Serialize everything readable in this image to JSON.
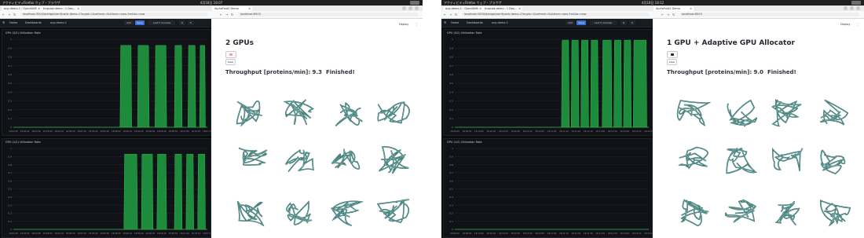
{
  "colors": {
    "topbar": "#1f1f1f",
    "grafana_bg": "#0b0c0e",
    "panel_bg": "#111217",
    "bar_fill": "#1e8a3c",
    "bar_line": "#2db84d",
    "protein": "#2f6e6a",
    "run_dot_left": "#f19fa3",
    "run_dot_right": "#262730"
  },
  "screens": [
    {
      "desktop": {
        "activities": "アクティビティ",
        "app": "Firefox ウェブ・ブラウザ",
        "clock": "4月18日 18:07"
      },
      "tabs": [
        "ocp-demo-1 : OpenShift",
        "tmpcad-demo : 1 Das…",
        "AlphaFold2 Demo"
      ],
      "url_left": "localhost:3000/d/edge/zamf/cacb-demo-1?orgId=1&refresh=5s&from=now-5m&to=now",
      "url_right": "localhost:8503",
      "grafana": {
        "nav": [
          "Home",
          "Dashboards",
          "ocp-demo-1"
        ],
        "buttons": [
          "Add",
          "Save",
          "Last 5 minutes"
        ],
        "panels": [
          {
            "title": "GPU (0/2) Utilization Rate",
            "y_ticks": [
              "1",
              "0.9",
              "0.8",
              "0.7",
              "0.6",
              "0.5",
              "0.4",
              "0.3",
              "0.2",
              "0.1",
              "0"
            ]
          },
          {
            "title": "GPU (1/2) Utilization Rate",
            "y_ticks": [
              "1",
              "0.9",
              "0.8",
              "0.7",
              "0.6",
              "0.5",
              "0.4",
              "0.3",
              "0.2",
              "0.1",
              "0"
            ]
          }
        ]
      },
      "streamlit": {
        "header_items": [
          "Deploy",
          "⋮"
        ],
        "title": "2 GPUs",
        "clear": "Clear",
        "throughput": "Throughput [proteins/min]: 9.3",
        "status": "Finished!"
      }
    },
    {
      "desktop": {
        "activities": "アクティビティ",
        "app": "Firefox ウェブ・ブラウザ",
        "clock": "4月18日 18:12"
      },
      "tabs": [
        "ocp-demo-1 : OpenShift",
        "tmpcad-demo : 1 Das…",
        "AlphaFold2 Demo"
      ],
      "url_left": "localhost:3000/d/edge/zamf/cacb-demo-2?orgId=1&refresh=5s&from=now-5m&to=now",
      "url_right": "localhost:8503",
      "grafana": {
        "nav": [
          "Home",
          "Dashboards",
          "ocp-demo-1"
        ],
        "buttons": [
          "Add",
          "Save",
          "Last 5 minutes"
        ],
        "panels": [
          {
            "title": "GPU (0/2) Utilization Rate",
            "y_ticks": [
              "1",
              "0.9",
              "0.8",
              "0.7",
              "0.6",
              "0.5",
              "0.4",
              "0.3",
              "0.2",
              "0.1",
              "0"
            ]
          },
          {
            "title": "GPU (1/2) Utilization Rate",
            "y_ticks": [
              "1",
              "0.9",
              "0.8",
              "0.7",
              "0.6",
              "0.5",
              "0.4",
              "0.3",
              "0.2",
              "0.1",
              "0"
            ]
          }
        ]
      },
      "streamlit": {
        "header_items": [
          "Deploy",
          "⋮"
        ],
        "title": "1 GPU + Adaptive GPU Allocator",
        "clear": "Clear",
        "throughput": "Throughput [proteins/min]: 9.0",
        "status": "Finished!"
      }
    }
  ],
  "chart_data": [
    {
      "type": "area",
      "title": "GPU (0/2) Utilization Rate",
      "screen": 1,
      "ylim": [
        0,
        1
      ],
      "x": [
        "18:04:30",
        "18:04:40",
        "18:04:50",
        "18:05:00",
        "18:05:10",
        "18:05:20",
        "18:05:30",
        "18:05:40",
        "18:05:50",
        "18:06:00",
        "18:06:10",
        "18:06:20",
        "18:06:30",
        "18:06:40",
        "18:06:50",
        "18:07:00",
        "18:07:10",
        "18:07:20"
      ],
      "bursts": [
        [
          0.55,
          0.61
        ],
        [
          0.64,
          0.7
        ],
        [
          0.73,
          0.79
        ],
        [
          0.83,
          0.87
        ],
        [
          0.9,
          0.94
        ],
        [
          0.96,
          0.99
        ]
      ],
      "peak": 0.93
    },
    {
      "type": "area",
      "title": "GPU (1/2) Utilization Rate",
      "screen": 1,
      "ylim": [
        0,
        1
      ],
      "x": [
        "18:04:30",
        "18:04:40",
        "18:04:50",
        "18:05:00",
        "18:05:10",
        "18:05:20",
        "18:05:30",
        "18:05:40",
        "18:05:50",
        "18:06:00",
        "18:06:10",
        "18:06:20",
        "18:06:30",
        "18:06:40",
        "18:06:50",
        "18:07:00",
        "18:07:10",
        "18:07:20"
      ],
      "bursts": [
        [
          0.57,
          0.64
        ],
        [
          0.66,
          0.72
        ],
        [
          0.74,
          0.79
        ],
        [
          0.83,
          0.87
        ],
        [
          0.89,
          0.93
        ],
        [
          0.95,
          0.99
        ]
      ],
      "peak": 0.93
    },
    {
      "type": "area",
      "title": "GPU (0/2) Utilization Rate",
      "screen": 2,
      "ylim": [
        0,
        1
      ],
      "x": [
        "18:09:40",
        "18:09:50",
        "18:10:00",
        "18:10:10",
        "18:10:20",
        "18:10:30",
        "18:10:40",
        "18:10:50",
        "18:11:00",
        "18:11:10",
        "18:11:20",
        "18:11:30",
        "18:11:40",
        "18:11:50",
        "18:12:00",
        "18:12:10",
        "18:12:20"
      ],
      "bursts": [
        [
          0.55,
          0.59
        ],
        [
          0.6,
          0.64
        ],
        [
          0.65,
          0.69
        ],
        [
          0.7,
          0.74
        ],
        [
          0.76,
          0.81
        ],
        [
          0.82,
          0.86
        ],
        [
          0.87,
          0.91
        ],
        [
          0.92,
          0.99
        ]
      ],
      "peak": 0.99
    },
    {
      "type": "area",
      "title": "GPU (1/2) Utilization Rate",
      "screen": 2,
      "ylim": [
        0,
        1
      ],
      "x": [
        "18:09:40",
        "18:09:50",
        "18:10:00",
        "18:10:10",
        "18:10:20",
        "18:10:30",
        "18:10:40",
        "18:10:50",
        "18:11:00",
        "18:11:10",
        "18:11:20",
        "18:11:30",
        "18:11:40",
        "18:11:50",
        "18:12:00",
        "18:12:10",
        "18:12:20"
      ],
      "bursts": [],
      "peak": 0
    }
  ]
}
